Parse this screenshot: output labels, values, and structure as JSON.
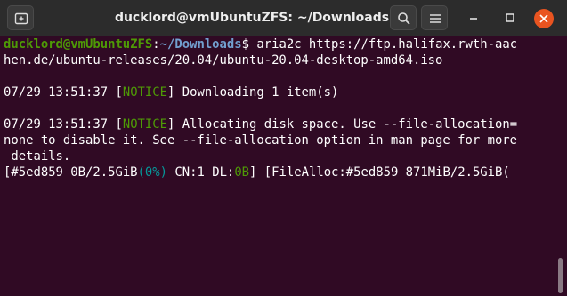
{
  "window": {
    "title": "ducklord@vmUbuntuZFS: ~/Downloads"
  },
  "titlebar": {
    "new_tab_icon": "new-tab-icon",
    "search_icon": "search-icon",
    "menu_icon": "hamburger-menu-icon",
    "minimize_icon": "minimize-icon",
    "maximize_icon": "maximize-icon",
    "close_icon": "close-icon"
  },
  "terminal": {
    "prompt_user": "ducklord@vmUbuntuZFS",
    "prompt_sep": ":",
    "prompt_path": "~/Downloads",
    "prompt_symbol": "$ ",
    "command_line1": "aria2c https://ftp.halifax.rwth-aac",
    "command_line2": "hen.de/ubuntu-releases/20.04/ubuntu-20.04-desktop-amd64.iso",
    "notice1_time": "07/29 13:51:37 ",
    "notice1_tag": "NOTICE",
    "notice1_text": " Downloading 1 item(s)",
    "notice2_time": "07/29 13:51:37 ",
    "notice2_tag": "NOTICE",
    "notice2_text_line1": " Allocating disk space. Use --file-allocation=",
    "notice2_text_line2": "none to disable it. See --file-allocation option in man page for more",
    "notice2_text_line3": " details.",
    "progress_gid": "#5ed859 0B/2.5GiB",
    "progress_pct": "0%",
    "progress_cn": " CN:1 DL:",
    "progress_dl": "0B",
    "progress_alloc": " [FileAlloc:#5ed859 871MiB/2.5GiB("
  },
  "colors": {
    "terminal_bg": "#300a24",
    "prompt_user": "#4e9a06",
    "prompt_path": "#729fcf",
    "notice": "#4e9a06",
    "accent_close": "#e95420"
  }
}
